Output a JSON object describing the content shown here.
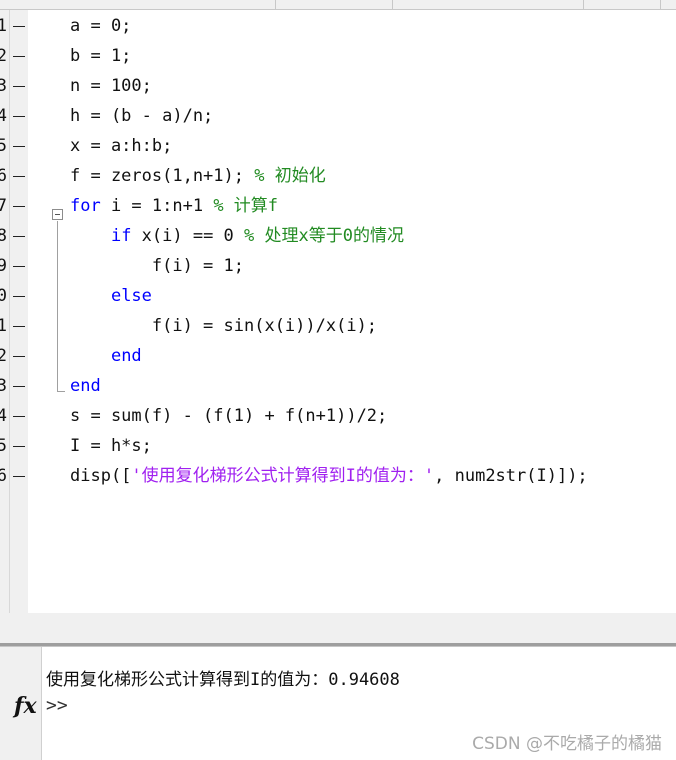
{
  "lines": [
    {
      "num": "1",
      "segs": [
        {
          "t": "a = 0;",
          "c": ""
        }
      ]
    },
    {
      "num": "2",
      "segs": [
        {
          "t": "b = 1;",
          "c": ""
        }
      ]
    },
    {
      "num": "3",
      "segs": [
        {
          "t": "n = 100;",
          "c": ""
        }
      ]
    },
    {
      "num": "4",
      "segs": [
        {
          "t": "h = (b - a)/n;",
          "c": ""
        }
      ]
    },
    {
      "num": "5",
      "segs": [
        {
          "t": "x = a:h:b;",
          "c": ""
        }
      ]
    },
    {
      "num": "6",
      "segs": [
        {
          "t": "f = zeros(1,n+1); ",
          "c": ""
        },
        {
          "t": "% 初始化",
          "c": "cm"
        }
      ]
    },
    {
      "num": "7",
      "segs": [
        {
          "t": "for",
          "c": "kw"
        },
        {
          "t": " i = 1:n+1 ",
          "c": ""
        },
        {
          "t": "% 计算f",
          "c": "cm"
        }
      ]
    },
    {
      "num": "8",
      "segs": [
        {
          "t": "    ",
          "c": ""
        },
        {
          "t": "if",
          "c": "kw"
        },
        {
          "t": " x(i) == 0 ",
          "c": ""
        },
        {
          "t": "% 处理x等于0的情况",
          "c": "cm"
        }
      ]
    },
    {
      "num": "9",
      "segs": [
        {
          "t": "        f(i) = 1;",
          "c": ""
        }
      ]
    },
    {
      "num": "0",
      "segs": [
        {
          "t": "    ",
          "c": ""
        },
        {
          "t": "else",
          "c": "kw"
        }
      ]
    },
    {
      "num": "1",
      "segs": [
        {
          "t": "        f(i) = sin(x(i))/x(i);",
          "c": ""
        }
      ]
    },
    {
      "num": "2",
      "segs": [
        {
          "t": "    ",
          "c": ""
        },
        {
          "t": "end",
          "c": "kw"
        }
      ]
    },
    {
      "num": "3",
      "segs": [
        {
          "t": "end",
          "c": "kw"
        }
      ]
    },
    {
      "num": "4",
      "segs": [
        {
          "t": "s = sum(f) - (f(1) + f(n+1))/2;",
          "c": ""
        }
      ]
    },
    {
      "num": "5",
      "segs": [
        {
          "t": "I = h*s;",
          "c": ""
        }
      ]
    },
    {
      "num": "6",
      "segs": [
        {
          "t": "disp([",
          "c": ""
        },
        {
          "t": "'使用复化梯形公式计算得到I的值为：'",
          "c": "st"
        },
        {
          "t": ", num2str(I)]);",
          "c": ""
        }
      ]
    }
  ],
  "command_window": {
    "output": "使用复化梯形公式计算得到I的值为：0.94608",
    "prompt": ">>",
    "fx_icon": "fx-icon"
  },
  "watermark": "CSDN @不吃橘子的橘猫",
  "colors": {
    "keyword": "#0000ff",
    "comment": "#228b22",
    "string": "#a020f0"
  }
}
